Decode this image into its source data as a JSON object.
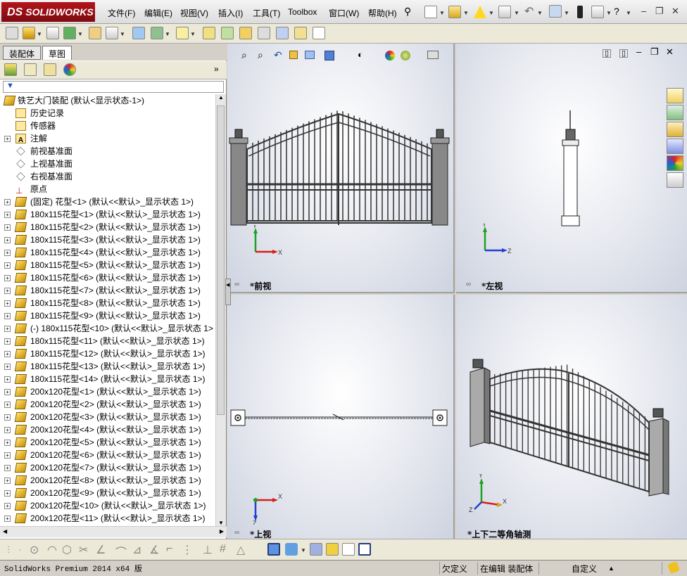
{
  "app": {
    "logo": "SOLIDWORKS",
    "logo_prefix": "DS"
  },
  "menu": [
    "文件(F)",
    "编辑(E)",
    "视图(V)",
    "插入(I)",
    "工具(T)",
    "Toolbox",
    "窗口(W)",
    "帮助(H)"
  ],
  "left_panel": {
    "tabs": [
      "装配体",
      "草图"
    ],
    "active_tab": "草图",
    "tree": [
      {
        "label": "铁艺大门装配  (默认<显示状态-1>)",
        "icon": "assembly",
        "expand": false,
        "indent": 0
      },
      {
        "label": "历史记录",
        "icon": "folder",
        "expand": false,
        "indent": 1
      },
      {
        "label": "传感器",
        "icon": "folder",
        "expand": false,
        "indent": 1
      },
      {
        "label": "注解",
        "icon": "annotation",
        "expand": true,
        "indent": 1
      },
      {
        "label": "前视基准面",
        "icon": "plane",
        "expand": false,
        "indent": 1
      },
      {
        "label": "上视基准面",
        "icon": "plane",
        "expand": false,
        "indent": 1
      },
      {
        "label": "右视基准面",
        "icon": "plane",
        "expand": false,
        "indent": 1
      },
      {
        "label": "原点",
        "icon": "origin",
        "expand": false,
        "indent": 1
      },
      {
        "label": "(固定) 花型<1> (默认<<默认>_显示状态 1>)",
        "icon": "part",
        "expand": true,
        "indent": 1
      },
      {
        "label": "180x115花型<1> (默认<<默认>_显示状态 1>)",
        "icon": "part",
        "expand": true,
        "indent": 1
      },
      {
        "label": "180x115花型<2> (默认<<默认>_显示状态 1>)",
        "icon": "part",
        "expand": true,
        "indent": 1
      },
      {
        "label": "180x115花型<3> (默认<<默认>_显示状态 1>)",
        "icon": "part",
        "expand": true,
        "indent": 1
      },
      {
        "label": "180x115花型<4> (默认<<默认>_显示状态 1>)",
        "icon": "part",
        "expand": true,
        "indent": 1
      },
      {
        "label": "180x115花型<5> (默认<<默认>_显示状态 1>)",
        "icon": "part",
        "expand": true,
        "indent": 1
      },
      {
        "label": "180x115花型<6> (默认<<默认>_显示状态 1>)",
        "icon": "part",
        "expand": true,
        "indent": 1
      },
      {
        "label": "180x115花型<7> (默认<<默认>_显示状态 1>)",
        "icon": "part",
        "expand": true,
        "indent": 1
      },
      {
        "label": "180x115花型<8> (默认<<默认>_显示状态 1>)",
        "icon": "part",
        "expand": true,
        "indent": 1
      },
      {
        "label": "180x115花型<9> (默认<<默认>_显示状态 1>)",
        "icon": "part",
        "expand": true,
        "indent": 1
      },
      {
        "label": "(-) 180x115花型<10> (默认<<默认>_显示状态 1>",
        "icon": "part",
        "expand": true,
        "indent": 1
      },
      {
        "label": "180x115花型<11> (默认<<默认>_显示状态 1>)",
        "icon": "part",
        "expand": true,
        "indent": 1
      },
      {
        "label": "180x115花型<12> (默认<<默认>_显示状态 1>)",
        "icon": "part",
        "expand": true,
        "indent": 1
      },
      {
        "label": "180x115花型<13> (默认<<默认>_显示状态 1>)",
        "icon": "part",
        "expand": true,
        "indent": 1
      },
      {
        "label": "180x115花型<14> (默认<<默认>_显示状态 1>)",
        "icon": "part",
        "expand": true,
        "indent": 1
      },
      {
        "label": "200x120花型<1> (默认<<默认>_显示状态 1>)",
        "icon": "part",
        "expand": true,
        "indent": 1
      },
      {
        "label": "200x120花型<2> (默认<<默认>_显示状态 1>)",
        "icon": "part",
        "expand": true,
        "indent": 1
      },
      {
        "label": "200x120花型<3> (默认<<默认>_显示状态 1>)",
        "icon": "part",
        "expand": true,
        "indent": 1
      },
      {
        "label": "200x120花型<4> (默认<<默认>_显示状态 1>)",
        "icon": "part",
        "expand": true,
        "indent": 1
      },
      {
        "label": "200x120花型<5> (默认<<默认>_显示状态 1>)",
        "icon": "part",
        "expand": true,
        "indent": 1
      },
      {
        "label": "200x120花型<6> (默认<<默认>_显示状态 1>)",
        "icon": "part",
        "expand": true,
        "indent": 1
      },
      {
        "label": "200x120花型<7> (默认<<默认>_显示状态 1>)",
        "icon": "part",
        "expand": true,
        "indent": 1
      },
      {
        "label": "200x120花型<8> (默认<<默认>_显示状态 1>)",
        "icon": "part",
        "expand": true,
        "indent": 1
      },
      {
        "label": "200x120花型<9> (默认<<默认>_显示状态 1>)",
        "icon": "part",
        "expand": true,
        "indent": 1
      },
      {
        "label": "200x120花型<10> (默认<<默认>_显示状态 1>)",
        "icon": "part",
        "expand": true,
        "indent": 1
      },
      {
        "label": "200x120花型<11> (默认<<默认>_显示状态 1>)",
        "icon": "part",
        "expand": true,
        "indent": 1
      }
    ]
  },
  "viewports": {
    "front": {
      "label": "*前视",
      "axes": {
        "x": "X",
        "y": "Y"
      }
    },
    "left": {
      "label": "*左视",
      "axes": {
        "z": "Z",
        "y": "Y"
      }
    },
    "top": {
      "label": "*上视",
      "axes": {
        "x": "X",
        "z": "Z"
      }
    },
    "iso": {
      "label": "*上下二等角轴测",
      "axes": {
        "x": "X",
        "y": "Y",
        "z": "Z"
      }
    }
  },
  "statusbar": {
    "product": "SolidWorks Premium 2014 x64 版",
    "constraint": "欠定义",
    "mode": "在编辑 装配体",
    "units": "自定义",
    "units_arrow": "▲"
  },
  "colors": {
    "logo_red": "#b4141c",
    "axis_x": "#d42020",
    "axis_y": "#20a020",
    "axis_z": "#2040d0",
    "gate": "#3a3a3a"
  }
}
